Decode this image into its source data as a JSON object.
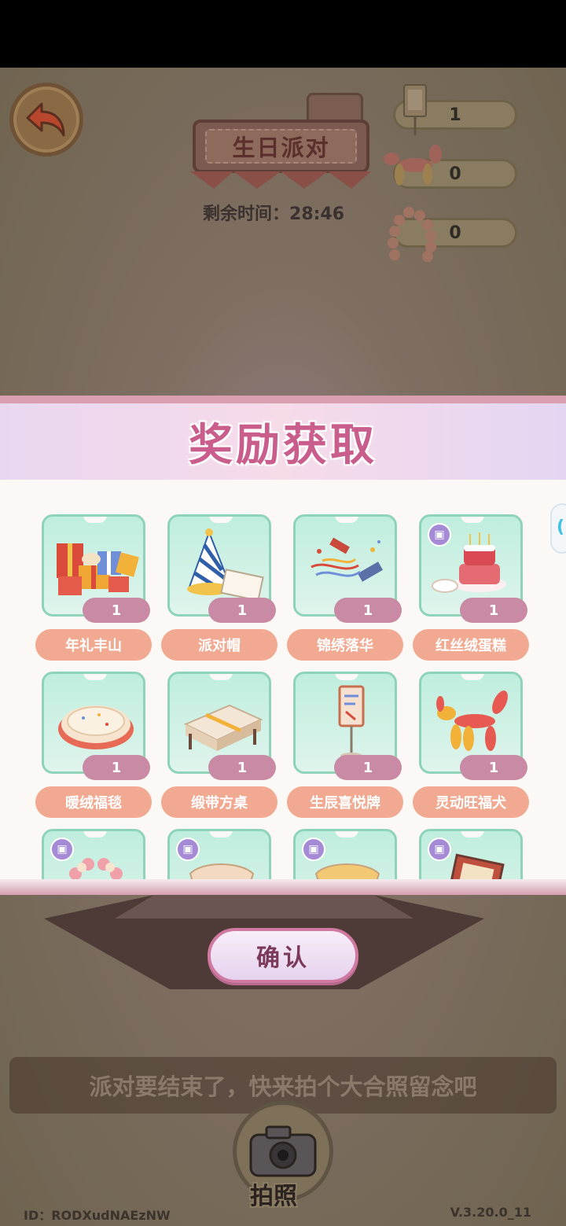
{
  "header": {
    "title": "生日派对",
    "timer_label": "剩余时间：",
    "timer_value": "28:46"
  },
  "counters": [
    {
      "icon": "sign-board-icon",
      "value": "1"
    },
    {
      "icon": "balloon-dog-icon",
      "value": "0"
    },
    {
      "icon": "balloon-arch-icon",
      "value": "0"
    }
  ],
  "reward_panel": {
    "title": "奖励获取",
    "items": [
      {
        "name": "年礼丰山",
        "qty": "1",
        "icon": "gift-pile-icon",
        "tagged": false
      },
      {
        "name": "派对帽",
        "qty": "1",
        "icon": "party-hat-icon",
        "tagged": false
      },
      {
        "name": "锦绣落华",
        "qty": "1",
        "icon": "confetti-popper-icon",
        "tagged": false
      },
      {
        "name": "红丝绒蛋糕",
        "qty": "1",
        "icon": "birthday-cake-icon",
        "tagged": true
      },
      {
        "name": "暖绒福毯",
        "qty": "1",
        "icon": "rug-icon",
        "tagged": false
      },
      {
        "name": "缎带方桌",
        "qty": "1",
        "icon": "ribbon-table-icon",
        "tagged": false
      },
      {
        "name": "生辰喜悦牌",
        "qty": "1",
        "icon": "sign-board-icon",
        "tagged": false
      },
      {
        "name": "灵动旺福犬",
        "qty": "1",
        "icon": "balloon-dog-icon",
        "tagged": false
      },
      {
        "name": "",
        "qty": "",
        "icon": "balloon-arch-icon",
        "tagged": true
      },
      {
        "name": "",
        "qty": "",
        "icon": "cushion-icon",
        "tagged": true
      },
      {
        "name": "",
        "qty": "",
        "icon": "cushion-icon",
        "tagged": true
      },
      {
        "name": "",
        "qty": "",
        "icon": "picture-frame-icon",
        "tagged": true
      }
    ]
  },
  "confirm_label": "确认",
  "hint_text": "派对要结束了，快来拍个大合照留念吧",
  "camera_label": "拍照",
  "footer": {
    "id_text": "ID：RODXudNAEzNW",
    "version": "V.3.20.0_11"
  },
  "colors": {
    "accent_pink": "#c95d8c",
    "card_green": "#bfeede",
    "name_pill": "#f2a991",
    "qty_pill": "#c98aa5"
  }
}
